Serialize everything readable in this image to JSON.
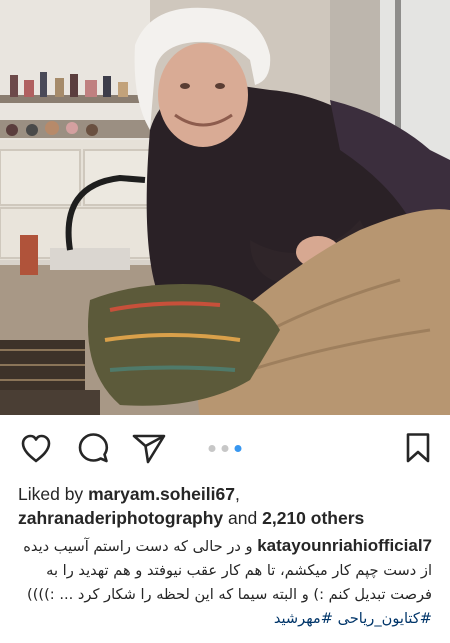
{
  "post": {
    "photo_alt": "photo",
    "carousel": {
      "count": 3,
      "active_index": 2
    }
  },
  "icons": {
    "like": "heart-icon",
    "comment": "comment-icon",
    "share": "send-icon",
    "save": "bookmark-icon"
  },
  "likes": {
    "prefix": "Liked by",
    "user1": "maryam.soheili67",
    "separator": ",",
    "user2": "zahranaderiphotography",
    "conjunction": "and",
    "others": "2,210 others"
  },
  "caption": {
    "username": "katayounriahiofficial7",
    "text": "و در حالی که دست راستم آسیب دیده از دست چپم کار میکشم، تا هم کار عقب نیوفتد و هم تهدید را به فرصت تبدیل کنم :) و البته سیما که این لحظه را شکار کرد ... :))))",
    "hashtags": "#کتایون_ریاحی #مهرشید"
  },
  "colors": {
    "accent_blue": "#3897f0",
    "text": "#262626",
    "hashtag": "#003569"
  }
}
